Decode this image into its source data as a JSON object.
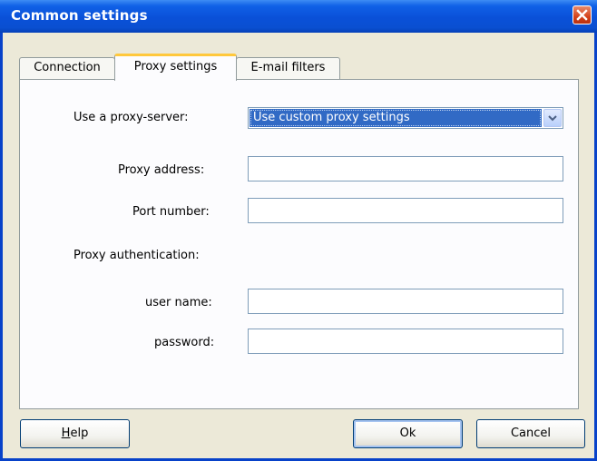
{
  "window": {
    "title": "Common settings",
    "close_icon": "close-icon",
    "close_color": "#d5421b"
  },
  "tabs": [
    {
      "label": "Connection",
      "active": false
    },
    {
      "label": "Proxy settings",
      "active": true
    },
    {
      "label": "E-mail filters",
      "active": false
    }
  ],
  "proxy": {
    "use_proxy_label": "Use a proxy-server:",
    "use_proxy_value": "Use custom proxy settings",
    "address_label": "Proxy address:",
    "address_value": "",
    "port_label": "Port number:",
    "port_value": "",
    "auth_label": "Proxy authentication:",
    "user_label": "user name:",
    "user_value": "",
    "password_label": "password:",
    "password_value": ""
  },
  "buttons": {
    "help_mnemonic": "H",
    "help_rest": "elp",
    "ok": "Ok",
    "cancel": "Cancel"
  }
}
